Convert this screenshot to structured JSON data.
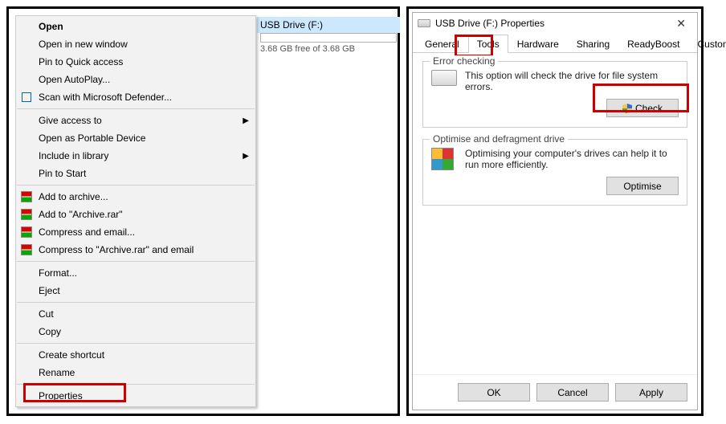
{
  "drive": {
    "label": "USB Drive (F:)",
    "free_text": "3.68 GB free of 3.68 GB"
  },
  "context_menu": {
    "items": [
      {
        "label": "Open",
        "bold": true
      },
      {
        "label": "Open in new window"
      },
      {
        "label": "Pin to Quick access"
      },
      {
        "label": "Open AutoPlay..."
      },
      {
        "label": "Scan with Microsoft Defender...",
        "icon": "defender"
      },
      {
        "sep": true
      },
      {
        "label": "Give access to",
        "submenu": true
      },
      {
        "label": "Open as Portable Device"
      },
      {
        "label": "Include in library",
        "submenu": true
      },
      {
        "label": "Pin to Start"
      },
      {
        "sep": true
      },
      {
        "label": "Add to archive...",
        "icon": "rar"
      },
      {
        "label": "Add to \"Archive.rar\"",
        "icon": "rar"
      },
      {
        "label": "Compress and email...",
        "icon": "rar"
      },
      {
        "label": "Compress to \"Archive.rar\" and email",
        "icon": "rar"
      },
      {
        "sep": true
      },
      {
        "label": "Format..."
      },
      {
        "label": "Eject"
      },
      {
        "sep": true
      },
      {
        "label": "Cut"
      },
      {
        "label": "Copy"
      },
      {
        "sep": true
      },
      {
        "label": "Create shortcut"
      },
      {
        "label": "Rename"
      },
      {
        "sep": true
      },
      {
        "label": "Properties"
      }
    ]
  },
  "dialog": {
    "title": "USB Drive (F:) Properties",
    "tabs": [
      "General",
      "Tools",
      "Hardware",
      "Sharing",
      "ReadyBoost",
      "Customise"
    ],
    "active_tab": "Tools",
    "error_checking": {
      "title": "Error checking",
      "text": "This option will check the drive for file system errors.",
      "button": "Check"
    },
    "optimise": {
      "title": "Optimise and defragment drive",
      "text": "Optimising your computer's drives can help it to run more efficiently.",
      "button": "Optimise"
    },
    "footer": {
      "ok": "OK",
      "cancel": "Cancel",
      "apply": "Apply"
    }
  }
}
